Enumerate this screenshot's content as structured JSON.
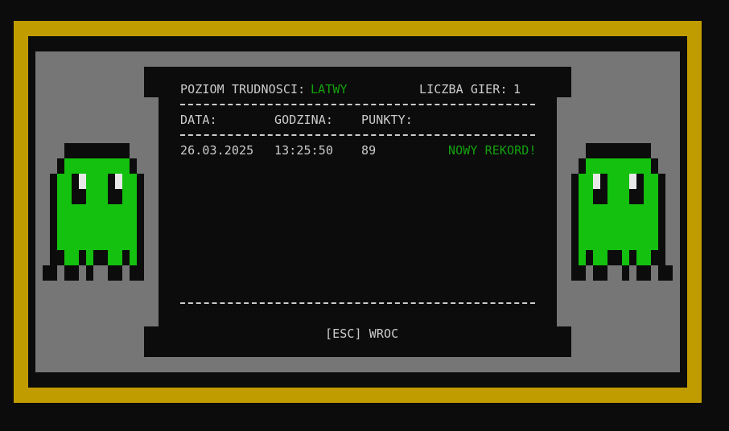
{
  "header": {
    "level_label": "POZIOM TRUDNOSCI:",
    "level_value": "LATWY",
    "games_label": "LICZBA GIER:",
    "games_value": "1"
  },
  "columns": [
    "DATA:",
    "GODZINA:",
    "PUNKTY:"
  ],
  "rows": [
    {
      "date": "26.03.2025",
      "time": "13:25:50",
      "points": "89",
      "note": "NOWY REKORD!"
    }
  ],
  "footer": {
    "back_label": "[ESC] WROC"
  },
  "icons": {
    "left": "green-ghost-icon",
    "right": "green-ghost-icon"
  },
  "colors": {
    "outer_frame": "#c19c00",
    "background": "#0c0c0c",
    "inner_frame": "#767676",
    "text": "#cccccc",
    "accent": "#13a10e",
    "ghost": "#13c10e"
  }
}
